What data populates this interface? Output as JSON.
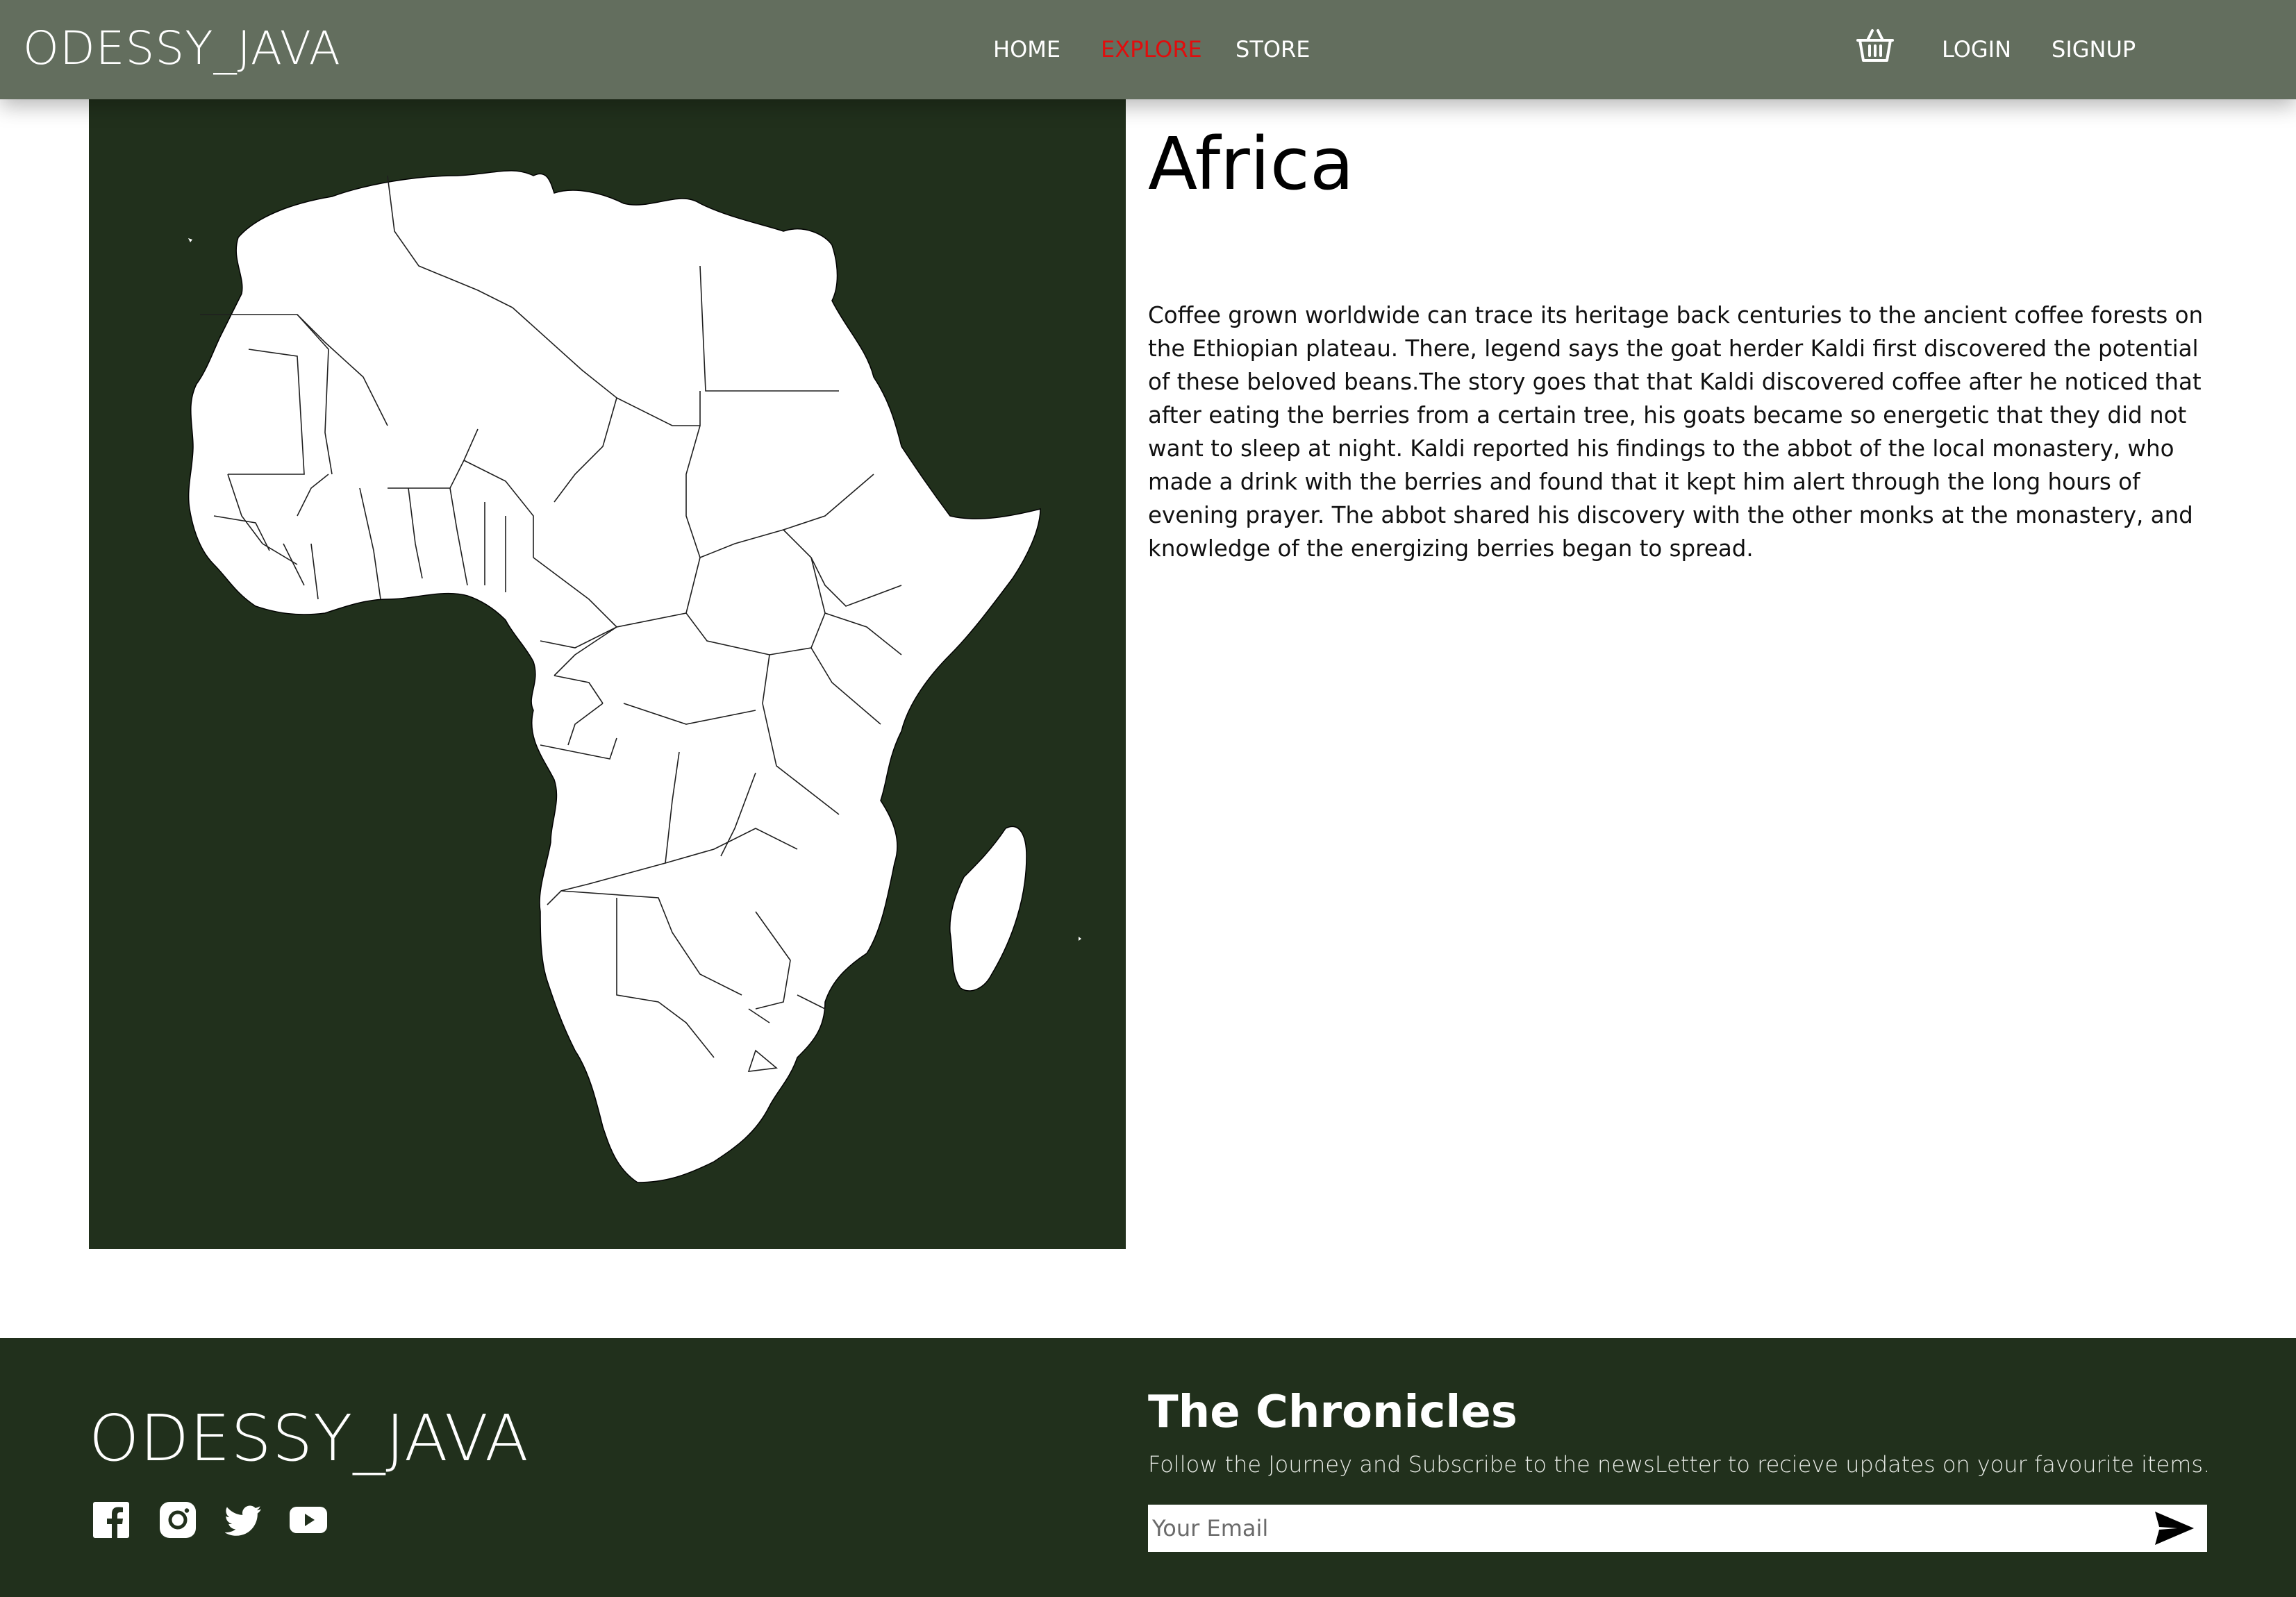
{
  "nav": {
    "brand": "ODESSY_JAVA",
    "links": [
      {
        "label": "HOME",
        "active": false
      },
      {
        "label": "EXPLORE",
        "active": true
      },
      {
        "label": "STORE",
        "active": false
      }
    ],
    "cart_icon": "shopping-basket-icon",
    "login": "LOGIN",
    "signup": "SIGNUP",
    "active_color": "#e10d0d",
    "bar_color": "#636e5e"
  },
  "map": {
    "icon": "africa-map",
    "background_color": "#21301c"
  },
  "article": {
    "title": "Africa",
    "body": "Coffee grown worldwide can trace its heritage back centuries to the ancient coffee forests on the Ethiopian plateau. There, legend says the goat herder Kaldi first discovered the potential of these beloved beans.The story goes that that Kaldi discovered coffee after he noticed that after eating the berries from a certain tree, his goats became so energetic that they did not want to sleep at night. Kaldi reported his findings to the abbot of the local monastery, who made a drink with the berries and found that it kept him alert through the long hours of evening prayer. The abbot shared his discovery with the other monks at the monastery, and knowledge of the energizing berries began to spread."
  },
  "footer": {
    "brand": "ODESSY_JAVA",
    "social_icons": [
      "facebook-icon",
      "instagram-icon",
      "twitter-icon",
      "youtube-icon"
    ],
    "chronicles_title": "The Chronicles",
    "chronicles_subtitle": "Follow the Journey and Subscribe to the newsLetter to recieve updates on your favourite items.",
    "email_placeholder": "Your Email",
    "send_icon": "send-arrow-icon",
    "background_color": "#21301c"
  }
}
